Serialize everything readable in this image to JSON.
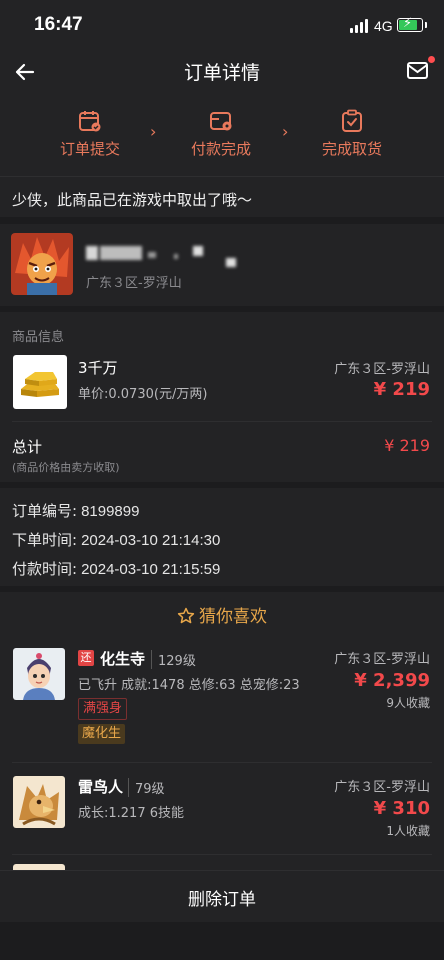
{
  "status_bar": {
    "time": "16:47",
    "network": "4G"
  },
  "nav": {
    "title": "订单详情"
  },
  "steps": [
    {
      "label": "订单提交",
      "icon": "calendar-check-icon"
    },
    {
      "label": "付款完成",
      "icon": "wallet-icon"
    },
    {
      "label": "完成取货",
      "icon": "clipboard-check-icon"
    }
  ],
  "notice": "少侠，此商品已在游戏中取出了哦～",
  "seller": {
    "region": "广东３区-罗浮山"
  },
  "goods": {
    "section_title": "商品信息",
    "name": "3千万",
    "unit_price": "单价:0.0730(元/万两)",
    "region": "广东３区-罗浮山",
    "price": "¥ 219",
    "total_label": "总计",
    "total_note": "(商品价格由卖方收取)",
    "total_price": "¥ 219"
  },
  "order": {
    "number_label": "订单编号:",
    "number": "8199899",
    "created_label": "下单时间:",
    "created": "2024-03-10 21:14:30",
    "paid_label": "付款时间:",
    "paid": "2024-03-10 21:15:59"
  },
  "recommend": {
    "title": "猜你喜欢",
    "items": [
      {
        "badge": "还",
        "name": "化生寺",
        "level": "129级",
        "attrs": "已飞升 成就:1478 总修:63 总宠修:23",
        "tags": [
          "满强身",
          "魔化生"
        ],
        "region": "广东３区-罗浮山",
        "price": "¥ 2,399",
        "favorites": "9人收藏"
      },
      {
        "name": "雷鸟人",
        "level": "79级",
        "attrs": "成长:1.217 6技能",
        "region": "广东３区-罗浮山",
        "price": "¥ 310",
        "favorites": "1人收藏"
      }
    ]
  },
  "bottom": {
    "delete_label": "删除订单"
  },
  "colors": {
    "accent": "#e8795c",
    "price": "#f2494b",
    "gold": "#e8a74a",
    "bg": "#1c1c1e",
    "card": "#232325"
  }
}
